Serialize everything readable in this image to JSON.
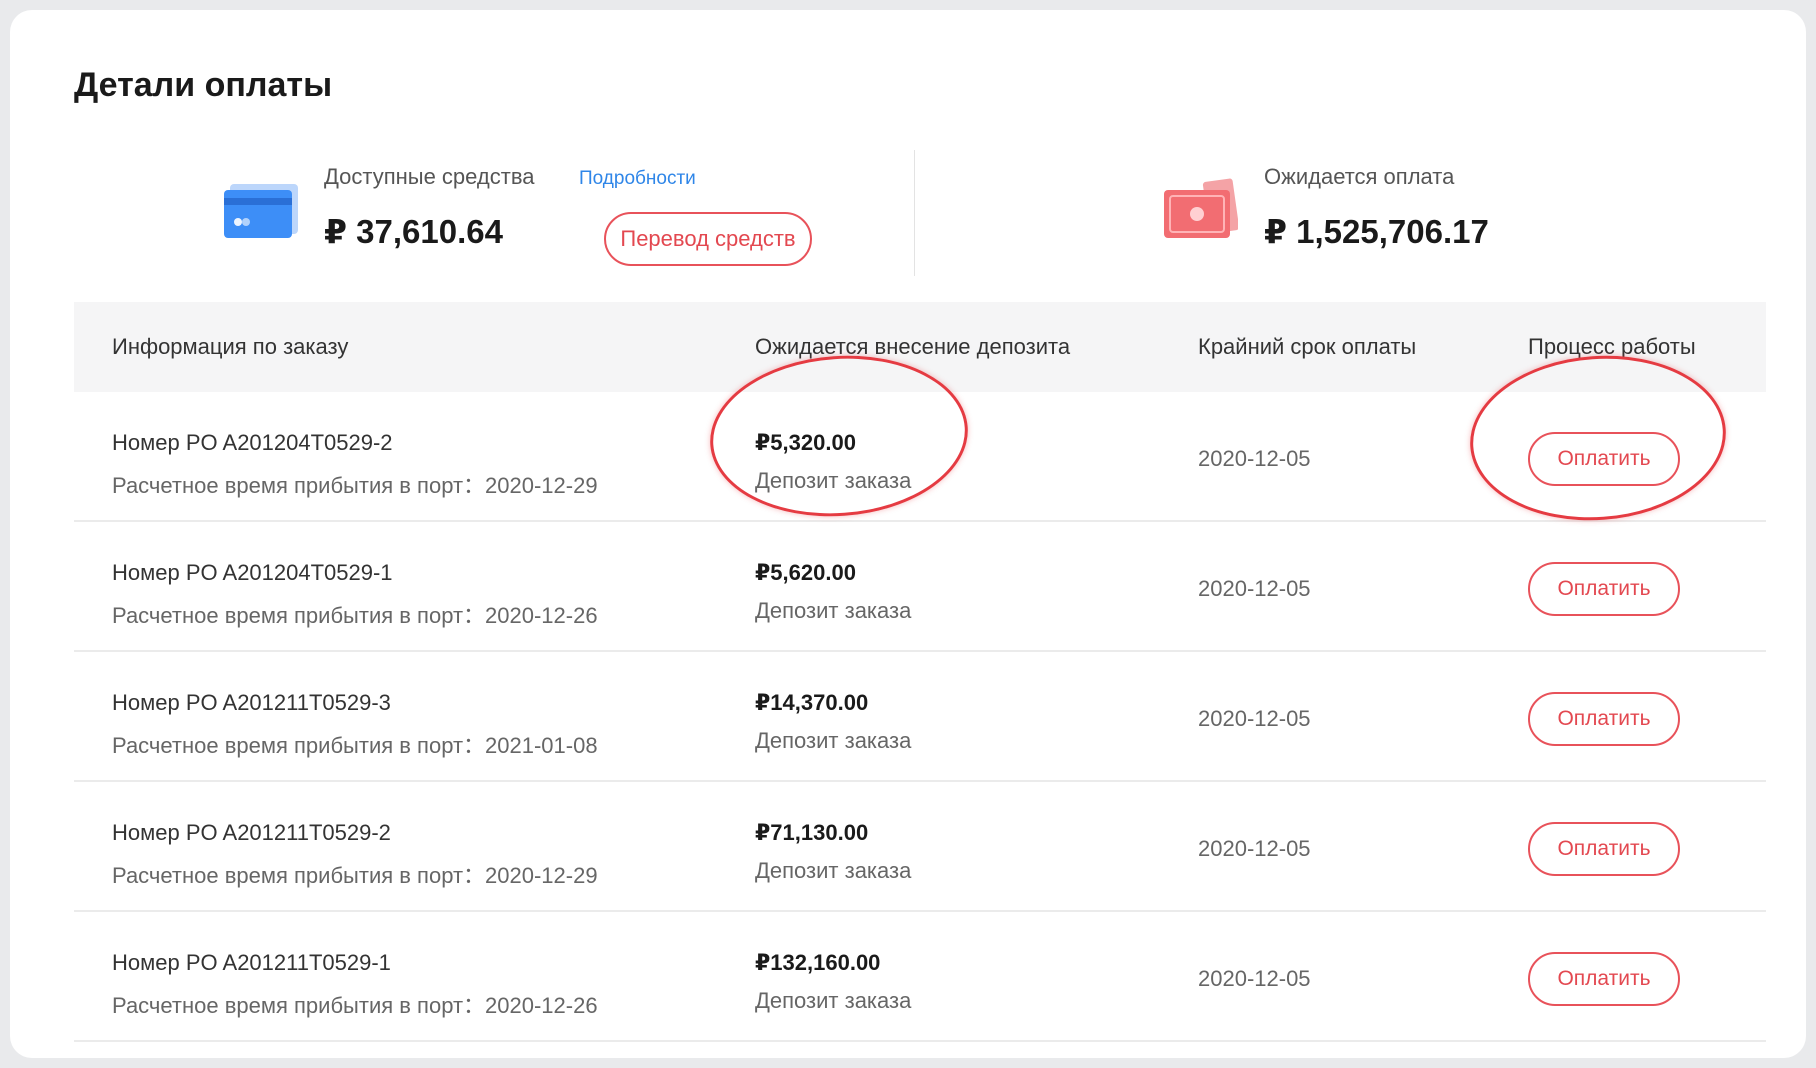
{
  "title": "Детали оплаты",
  "available": {
    "label": "Доступные средства",
    "details_link": "Подробности",
    "amount": "₽ 37,610.64",
    "transfer_button": "Перевод средств",
    "icon": "credit-card-icon"
  },
  "pending": {
    "label": "Ожидается оплата",
    "amount": "₽ 1,525,706.17",
    "icon": "cash-icon"
  },
  "table": {
    "headers": [
      "Информация по заказу",
      "Ожидается внесение депозита",
      "Крайний срок оплаты",
      "Процесс работы"
    ],
    "rows": [
      {
        "po": "Номер PO A201204T0529-2",
        "eta": "Расчетное время прибытия в порт：2020-12-29",
        "amount": "₽5,320.00",
        "deposit": "Депозит заказа",
        "due": "2020-12-05",
        "action": "Оплатить"
      },
      {
        "po": "Номер PO A201204T0529-1",
        "eta": "Расчетное время прибытия в порт：2020-12-26",
        "amount": "₽5,620.00",
        "deposit": "Депозит заказа",
        "due": "2020-12-05",
        "action": "Оплатить"
      },
      {
        "po": "Номер PO A201211T0529-3",
        "eta": "Расчетное время прибытия в порт：2021-01-08",
        "amount": "₽14,370.00",
        "deposit": "Депозит заказа",
        "due": "2020-12-05",
        "action": "Оплатить"
      },
      {
        "po": "Номер PO A201211T0529-2",
        "eta": "Расчетное время прибытия в порт：2020-12-29",
        "amount": "₽71,130.00",
        "deposit": "Депозит заказа",
        "due": "2020-12-05",
        "action": "Оплатить"
      },
      {
        "po": "Номер PO A201211T0529-1",
        "eta": "Расчетное время прибытия в порт：2020-12-26",
        "amount": "₽132,160.00",
        "deposit": "Депозит заказа",
        "due": "2020-12-05",
        "action": "Оплатить"
      }
    ]
  },
  "colors": {
    "accent": "#e8525a",
    "link": "#2f86e8",
    "annotation": "#e53b42"
  }
}
